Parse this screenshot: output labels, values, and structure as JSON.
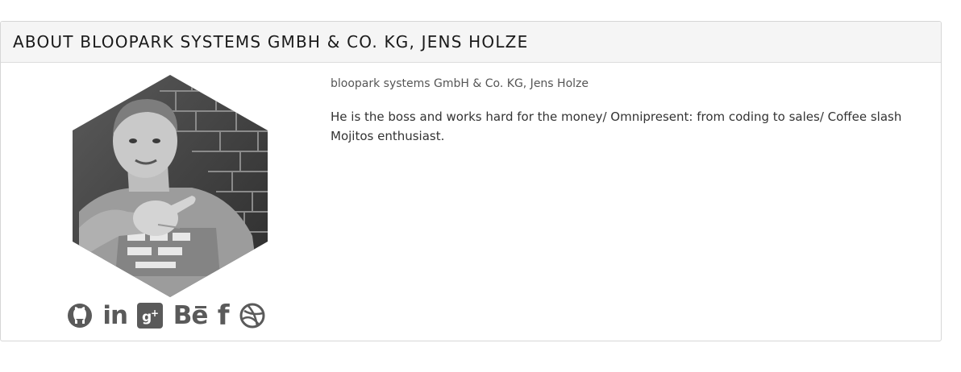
{
  "panel": {
    "title": "ABOUT BLOOPARK SYSTEMS GMBH & CO. KG, JENS HOLZE"
  },
  "author": {
    "name": "bloopark systems GmbH & Co. KG, Jens Holze",
    "description": "He is the boss and works hard for the money/ Omnipresent: from coding to sales/ Coffee slash Mojitos enthusiast.",
    "avatar_icon": "person-photo"
  },
  "social": [
    {
      "network": "GitHub",
      "icon": "github-icon"
    },
    {
      "network": "LinkedIn",
      "icon": "linkedin-icon",
      "glyph": "in"
    },
    {
      "network": "Google+",
      "icon": "google-plus-icon",
      "glyph": "g+"
    },
    {
      "network": "Behance",
      "icon": "behance-icon",
      "glyph": "Be"
    },
    {
      "network": "Facebook",
      "icon": "facebook-icon",
      "glyph": "f"
    },
    {
      "network": "Dribbble",
      "icon": "dribbble-icon"
    }
  ],
  "colors": {
    "header_bg": "#f5f5f5",
    "border": "#d6d6d6",
    "icon": "#5a5a5a",
    "text": "#333333"
  }
}
